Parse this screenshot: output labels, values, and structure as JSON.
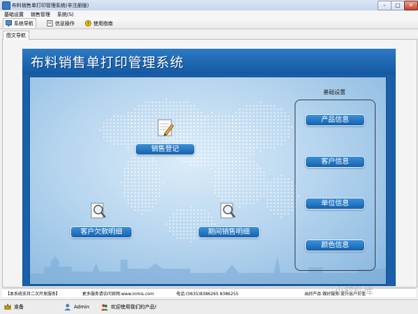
{
  "window": {
    "title": "布料销售单打印管理系统(非注册版)"
  },
  "menu": [
    "基础设置",
    "销售管理",
    "系统(S)"
  ],
  "toolbar": [
    "系统导航",
    "信息操作",
    "使用指南"
  ],
  "subtab": "图文导航",
  "app_title": "布料销售单打印管理系统",
  "features": {
    "sales_register": "销售登记",
    "customer_debt": "客户欠款明细",
    "period_sales": "期间销售明细"
  },
  "settings": {
    "title": "基础设置",
    "items": [
      "产品信息",
      "客户信息",
      "单位信息",
      "颜色信息"
    ]
  },
  "infostrip": {
    "dev": "【本系统支持二次开发服务】",
    "more": "更多服务请访问官网:www.inmis.com",
    "phone": "电话:(0635)8386265 8386255",
    "products": "出好产品  做好服务  提升客户价值"
  },
  "status": {
    "ready": "准备",
    "user": "Admin",
    "welcome": "欢迎使用我们的产品!"
  },
  "watermark": "小软件库"
}
